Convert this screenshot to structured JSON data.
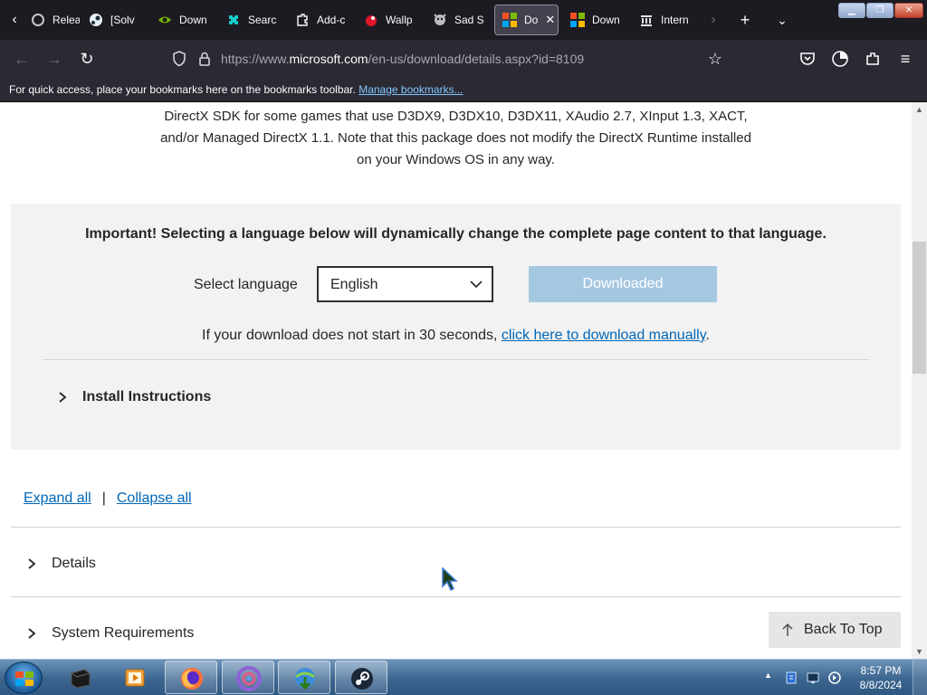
{
  "browser": {
    "tabs": [
      {
        "label": "Relea",
        "icon": "release-icon"
      },
      {
        "label": "[Solv",
        "icon": "steam-icon"
      },
      {
        "label": "Down",
        "icon": "nvidia-icon"
      },
      {
        "label": "Searc",
        "icon": "search-puzzle-icon"
      },
      {
        "label": "Add-c",
        "icon": "addon-puzzle-icon"
      },
      {
        "label": "Wallp",
        "icon": "wallpaper-icon"
      },
      {
        "label": "Sad S",
        "icon": "sad-satan-icon"
      },
      {
        "label": "Do",
        "icon": "microsoft-icon",
        "active": true
      },
      {
        "label": "Down",
        "icon": "microsoft-icon"
      },
      {
        "label": "Intern",
        "icon": "archive-icon"
      }
    ],
    "url_prefix": "https://www.",
    "url_domain": "microsoft.com",
    "url_path": "/en-us/download/details.aspx?id=8109",
    "bookmarks_message": "For quick access, place your bookmarks here on the bookmarks toolbar.",
    "bookmarks_link": "Manage bookmarks..."
  },
  "page": {
    "description_line1": "DirectX SDK for some games that use D3DX9, D3DX10, D3DX11, XAudio 2.7, XInput 1.3, XACT,",
    "description_line2": "and/or Managed DirectX 1.1. Note that this package does not modify the DirectX Runtime installed",
    "description_line3": "on your Windows OS in any way.",
    "important_notice": "Important! Selecting a language below will dynamically change the complete page content to that language.",
    "select_language_label": "Select language",
    "selected_language": "English",
    "download_button": "Downloaded",
    "manual_prefix": "If your download does not start in 30 seconds, ",
    "manual_link": "click here to download manually",
    "manual_suffix": ".",
    "install_instructions": "Install Instructions",
    "expand_all": "Expand all",
    "separator": "|",
    "collapse_all": "Collapse all",
    "accordion": {
      "details": "Details",
      "system_requirements": "System Requirements"
    },
    "back_to_top": "Back To Top",
    "colors": {
      "link": "#0067b8",
      "download_button_bg": "#a5c8e1",
      "panel_bg": "#f2f2f2"
    }
  },
  "taskbar": {
    "clock_time": "8:57 PM",
    "clock_date": "8/8/2024",
    "apps": [
      "file-manager-icon",
      "media-player-icon",
      "firefox-icon",
      "vs-installer-icon",
      "internet-download-manager-icon",
      "steam-icon"
    ]
  }
}
